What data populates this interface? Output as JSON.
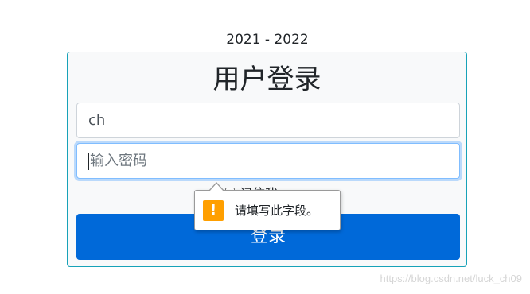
{
  "header": {
    "year_range": "2021 - 2022"
  },
  "login_card": {
    "title": "用户登录",
    "username": {
      "value": "ch"
    },
    "password": {
      "value": "",
      "placeholder": "输入密码"
    },
    "remember_label": "记住我",
    "submit_label": "登录"
  },
  "validation_tooltip": {
    "icon": "warning-icon",
    "icon_glyph": "!",
    "message": "请填写此字段。",
    "icon_color": "#ff9f00"
  },
  "watermark": {
    "text": "https://blog.csdn.net/luck_ch09"
  },
  "colors": {
    "primary_button": "#0069d9",
    "card_border": "#17a2b8",
    "focus_border": "#80bdff"
  }
}
